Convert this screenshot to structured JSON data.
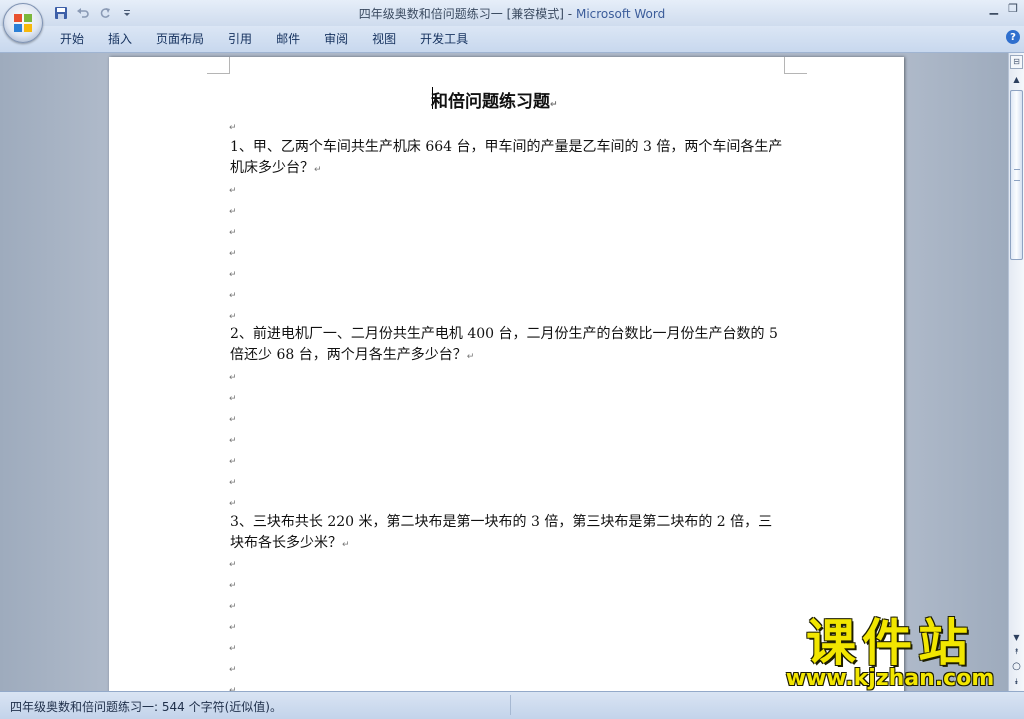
{
  "window": {
    "doc_name": "四年级奥数和倍问题练习一",
    "mode": "[兼容模式]",
    "separator": "-",
    "app_name": "Microsoft Word",
    "controls": [
      "▁",
      "❐"
    ]
  },
  "quick_access": {
    "save_icon": "save-icon",
    "undo_icon": "undo-icon",
    "redo_icon": "redo-icon",
    "customize_icon": "qat-customize-icon"
  },
  "ribbon": {
    "tabs": [
      "开始",
      "插入",
      "页面布局",
      "引用",
      "邮件",
      "审阅",
      "视图",
      "开发工具"
    ],
    "help": "?"
  },
  "document": {
    "title": "和倍问题练习题",
    "para_mark": "↵",
    "questions": [
      "1、甲、乙两个车间共生产机床 664 台，甲车间的产量是乙车间的 3 倍，两个车间各生产机床多少台？",
      "2、前进电机厂一、二月份共生产电机 400 台，二月份生产的台数比一月份生产台数的 5 倍还少 68 台，两个月各生产多少台？",
      "3、三块布共长 220 米，第二块布是第一块布的 3 倍，第三块布是第二块布的 2 倍，三块布各长多少米？"
    ]
  },
  "scrollbar": {
    "ruler_toggle": "⊟",
    "up": "▲",
    "down": "▼",
    "prev_page": "⯭",
    "browse_object": "○",
    "next_page": "⯯"
  },
  "status": {
    "text": "四年级奥数和倍问题练习一: 544 个字符(近似值)。"
  },
  "watermark": {
    "chinese": "课件站",
    "url": "www.kjzhan.com"
  },
  "colors": {
    "accent": "#3b5c9a",
    "watermark": "#f2e600"
  }
}
